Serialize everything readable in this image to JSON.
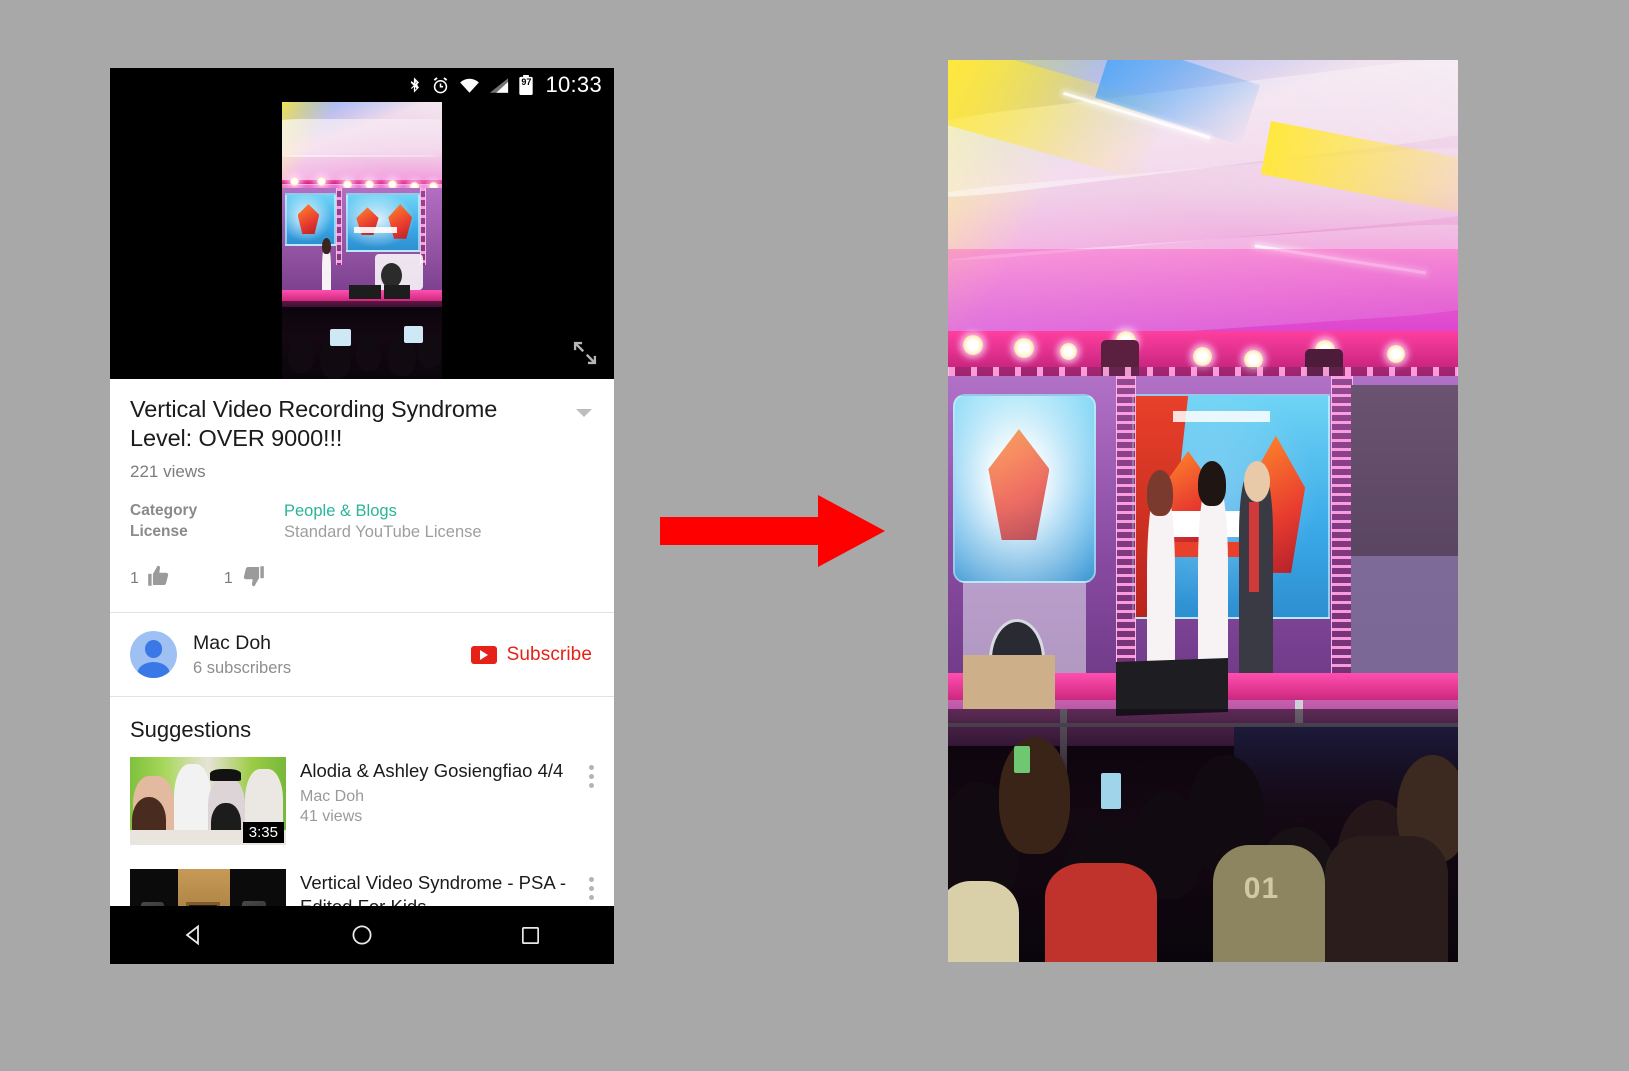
{
  "statusbar": {
    "icons": [
      "bluetooth-icon",
      "alarm-icon",
      "wifi-icon",
      "signal-icon",
      "battery-icon"
    ],
    "battery_level": "97",
    "time": "10:33"
  },
  "player": {
    "fullscreen_icon": "fullscreen-expand-icon",
    "video_orientation": "vertical"
  },
  "video": {
    "title": "Vertical Video Recording Syndrome Level: OVER 9000!!!",
    "views": "221 views",
    "expand_icon": "chevron-down-icon",
    "meta": [
      {
        "key": "Category",
        "value": "People & Blogs",
        "is_link": true
      },
      {
        "key": "License",
        "value": "Standard YouTube License",
        "is_link": false
      }
    ],
    "likes": {
      "count": "1",
      "icon": "thumbs-up-icon"
    },
    "dislikes": {
      "count": "1",
      "icon": "thumbs-down-icon"
    }
  },
  "channel": {
    "avatar_icon": "default-avatar-icon",
    "name": "Mac Doh",
    "subscribers": "6 subscribers",
    "subscribe_label": "Subscribe",
    "subscribe_icon": "youtube-play-icon"
  },
  "suggestions": {
    "heading": "Suggestions",
    "items": [
      {
        "title": "Alodia & Ashley Gosiengfiao 4/4",
        "channel": "Mac Doh",
        "views": "41 views",
        "duration": "3:35",
        "menu_icon": "kebab-menu-icon"
      },
      {
        "title": "Vertical Video Syndrome - PSA - Edited For Kids",
        "channel": "",
        "views": "",
        "duration": "",
        "menu_icon": "kebab-menu-icon"
      }
    ]
  },
  "navbar": {
    "back_icon": "back-triangle-icon",
    "home_icon": "home-circle-icon",
    "recents_icon": "recents-square-icon"
  },
  "annotation": {
    "arrow_icon": "right-arrow-icon",
    "arrow_color": "#FF0000",
    "direction": "right"
  },
  "photo": {
    "description": "Concert stage with pink and purple lighting, performers on stage, crowd in foreground",
    "jersey_number": "01"
  },
  "colors": {
    "background": "#a8a8a8",
    "accent_red": "#e62117",
    "link_teal": "#2ab598",
    "arrow_red": "#FF0000"
  }
}
